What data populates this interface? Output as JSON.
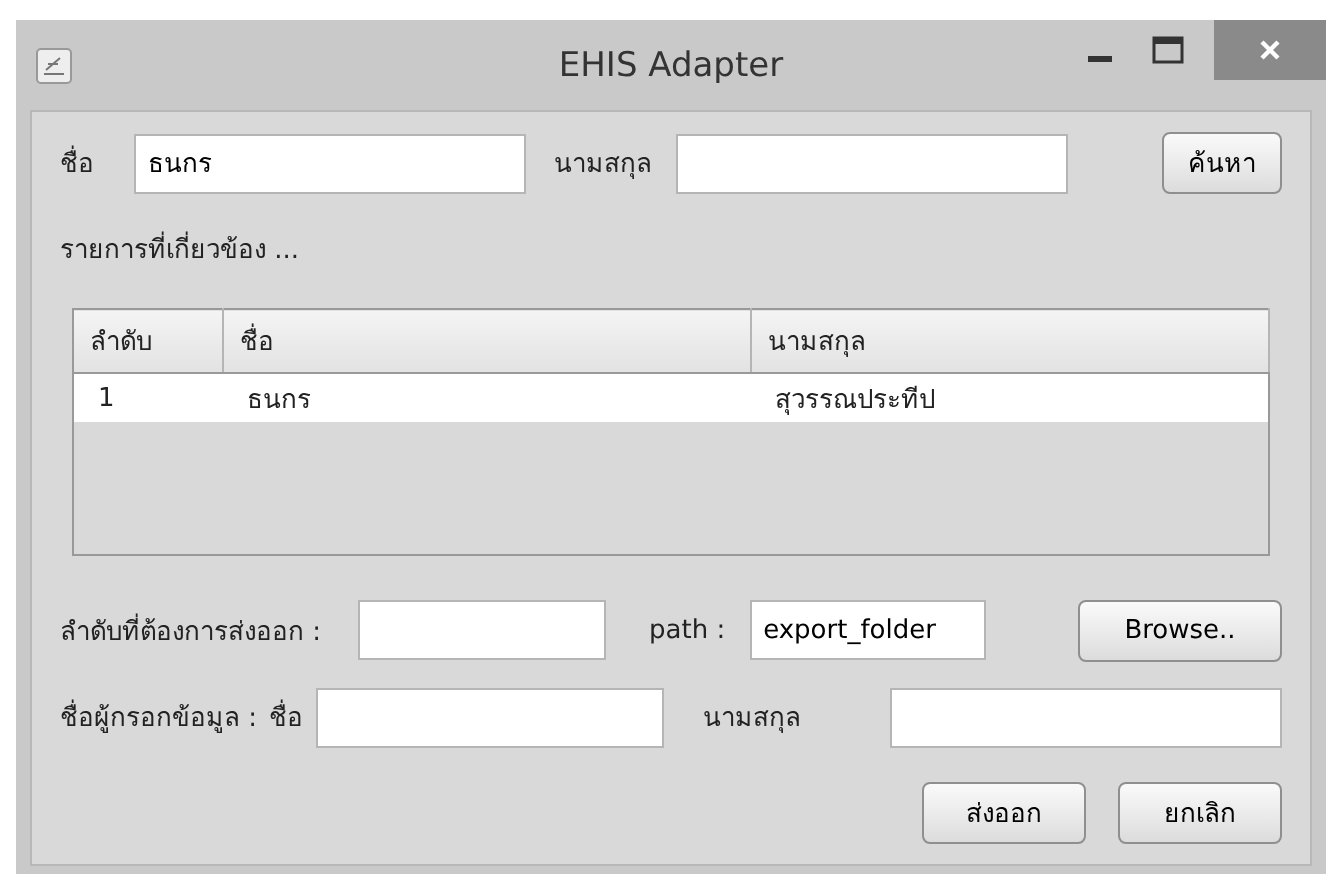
{
  "window": {
    "title": "EHIS Adapter"
  },
  "search": {
    "first_name_label": "ชื่อ",
    "first_name_value": "ธนกร",
    "last_name_label": "นามสกุล",
    "button": "ค้นหา"
  },
  "results_label": "รายการที่เกี่ยวข้อง ...",
  "table": {
    "columns": [
      "ลำดับ",
      "ชื่อ",
      "นามสกุล"
    ],
    "rows": [
      {
        "cells": [
          "1",
          "ธนกร",
          "สุวรรณประทีป"
        ],
        "selected": false
      }
    ]
  },
  "export": {
    "order_label": "ลำดับที่ต้องการส่งออก :",
    "path_label": "path :",
    "path_value": "export_folder",
    "browse_button": "Browse.."
  },
  "recorder": {
    "label": "ชื่อผู้กรอกข้อมูล :",
    "first_name_label": "ชื่อ",
    "last_name_label": "นามสกุล"
  },
  "buttons": [
    "ส่งออก",
    "ยกเลิก"
  ]
}
